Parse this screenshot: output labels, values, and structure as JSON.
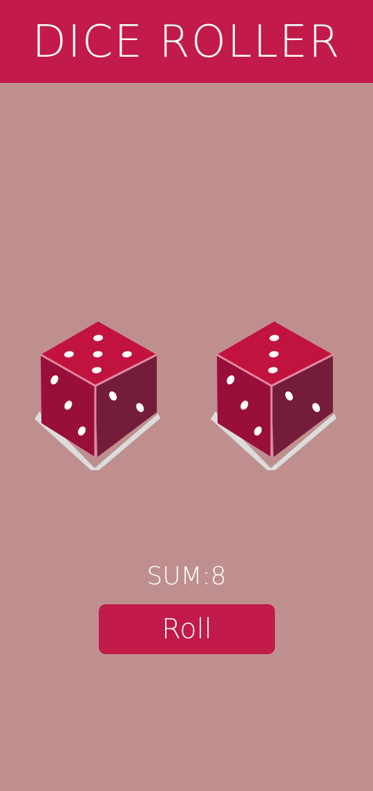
{
  "header": {
    "title": "DICE ROLLER"
  },
  "dice": [
    {
      "top_face": 5,
      "front_face": 3,
      "side_face": 2
    },
    {
      "top_face": 3,
      "front_face": 3,
      "side_face": 2
    }
  ],
  "sum": {
    "text": "SUM:8"
  },
  "roll_button": {
    "label": "Roll"
  },
  "colors": {
    "header": "#c21a49",
    "background": "#bf8f8f",
    "die_top": "#c2123f",
    "die_front": "#9a0e3a",
    "die_side": "#741d3b",
    "die_edge": "#e28aa0",
    "pip": "#ffffff",
    "shadow": "#dcdcdc"
  }
}
